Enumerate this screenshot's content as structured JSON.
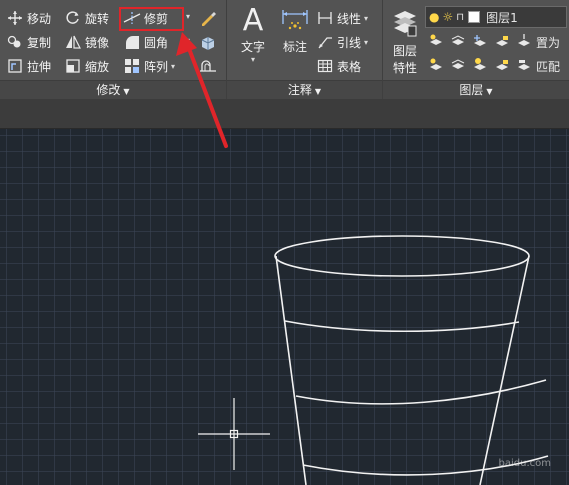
{
  "modify_panel": {
    "label": "修改",
    "move": "移动",
    "rotate": "旋转",
    "trim": "修剪",
    "copy": "复制",
    "mirror": "镜像",
    "fillet": "圆角",
    "stretch": "拉伸",
    "scale": "缩放",
    "array": "阵列"
  },
  "annotation_panel": {
    "label": "注释",
    "text": "文字",
    "dimension": "标注",
    "linear": "线性",
    "leader": "引线",
    "table": "表格"
  },
  "layers_panel": {
    "label": "图层",
    "layer_properties_line1": "图层",
    "layer_properties_line2": "特性",
    "current_layer": "图层1",
    "set_current": "置为",
    "match": "匹配"
  },
  "watermark": "baidu.com",
  "colors": {
    "highlight": "#e0252a",
    "ribbon": "#535353",
    "canvas": "#212830"
  }
}
